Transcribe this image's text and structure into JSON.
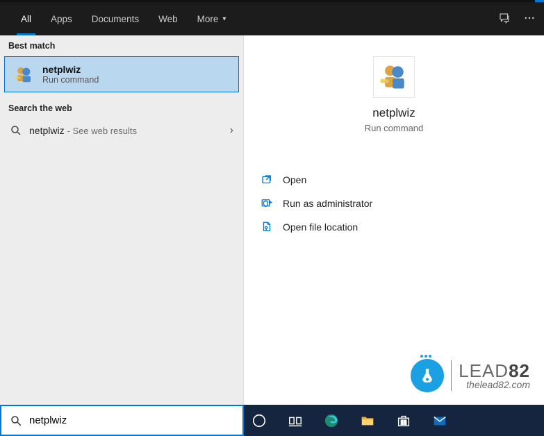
{
  "tabs": {
    "all": "All",
    "apps": "Apps",
    "documents": "Documents",
    "web": "Web",
    "more": "More"
  },
  "sections": {
    "best_match": "Best match",
    "search_web": "Search the web"
  },
  "result": {
    "title": "netplwiz",
    "subtitle": "Run command"
  },
  "web_result": {
    "term": "netplwiz",
    "hint": "- See web results"
  },
  "detail": {
    "title": "netplwiz",
    "subtitle": "Run command"
  },
  "actions": {
    "open": "Open",
    "run_admin": "Run as administrator",
    "open_loc": "Open file location"
  },
  "search": {
    "value": "netplwiz"
  },
  "logo": {
    "brand1": "LEAD",
    "brand2": "82",
    "url": "thelead82.com"
  }
}
